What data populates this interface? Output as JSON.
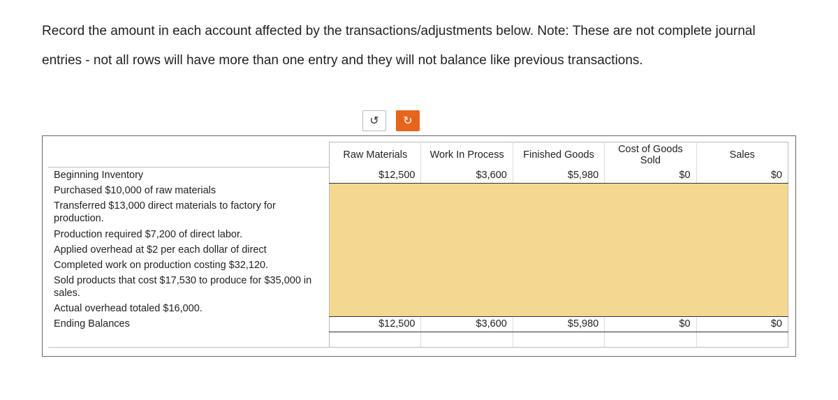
{
  "instructions": "Record the amount in each account affected by the transactions/adjustments below. Note: These are not complete journal entries  -  not all rows will have more than one entry and they will not balance like previous transactions.",
  "columns": [
    "Raw Materials",
    "Work In Process",
    "Finished Goods",
    "Cost of Goods Sold",
    "Sales"
  ],
  "rows": {
    "beginning": {
      "label": "Beginning Inventory",
      "values": [
        "$12,500",
        "$3,600",
        "$5,980",
        "$0",
        "$0"
      ]
    },
    "transactions": [
      "Purchased $10,000 of raw materials",
      "Transferred $13,000 direct materials to factory for production.",
      "Production required $7,200 of direct labor.",
      "Applied overhead at $2 per each dollar of direct",
      "Completed work on production costing $32,120.",
      "Sold products that cost $17,530 to produce for $35,000 in sales.",
      "Actual overhead totaled $16,000."
    ],
    "ending": {
      "label": "Ending Balances",
      "values": [
        "$12,500",
        "$3,600",
        "$5,980",
        "$0",
        "$0"
      ]
    }
  }
}
